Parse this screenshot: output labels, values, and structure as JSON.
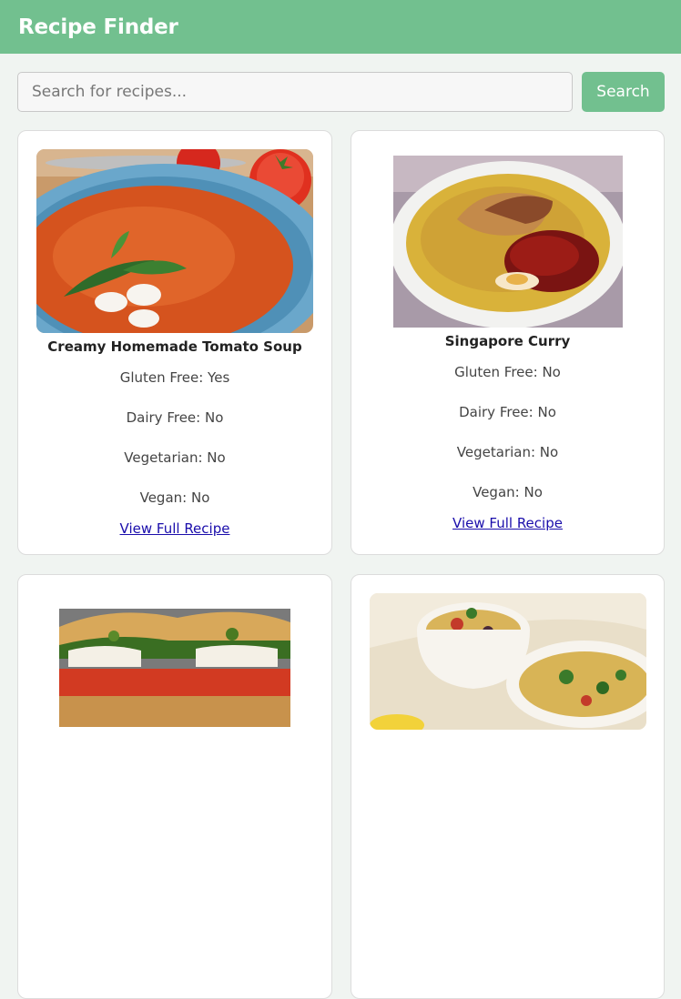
{
  "app": {
    "title": "Recipe Finder"
  },
  "search": {
    "placeholder": "Search for recipes...",
    "button_label": "Search"
  },
  "recipes": [
    {
      "name": "Creamy Homemade Tomato Soup",
      "gluten_free": "Gluten Free: Yes",
      "dairy_free": "Dairy Free: No",
      "vegetarian": "Vegetarian: No",
      "vegan": "Vegan: No",
      "link": "View Full Recipe",
      "image": "tomato-soup-photo"
    },
    {
      "name": "Singapore Curry",
      "gluten_free": "Gluten Free: No",
      "dairy_free": "Dairy Free: No",
      "vegetarian": "Vegetarian: No",
      "vegan": "Vegan: No",
      "link": "View Full Recipe",
      "image": "curry-photo"
    },
    {
      "image": "sandwich-photo"
    },
    {
      "image": "couscous-salad-photo"
    }
  ],
  "colors": {
    "accent": "#72c08f",
    "background": "#f0f4f1",
    "link": "#1a0dab"
  }
}
